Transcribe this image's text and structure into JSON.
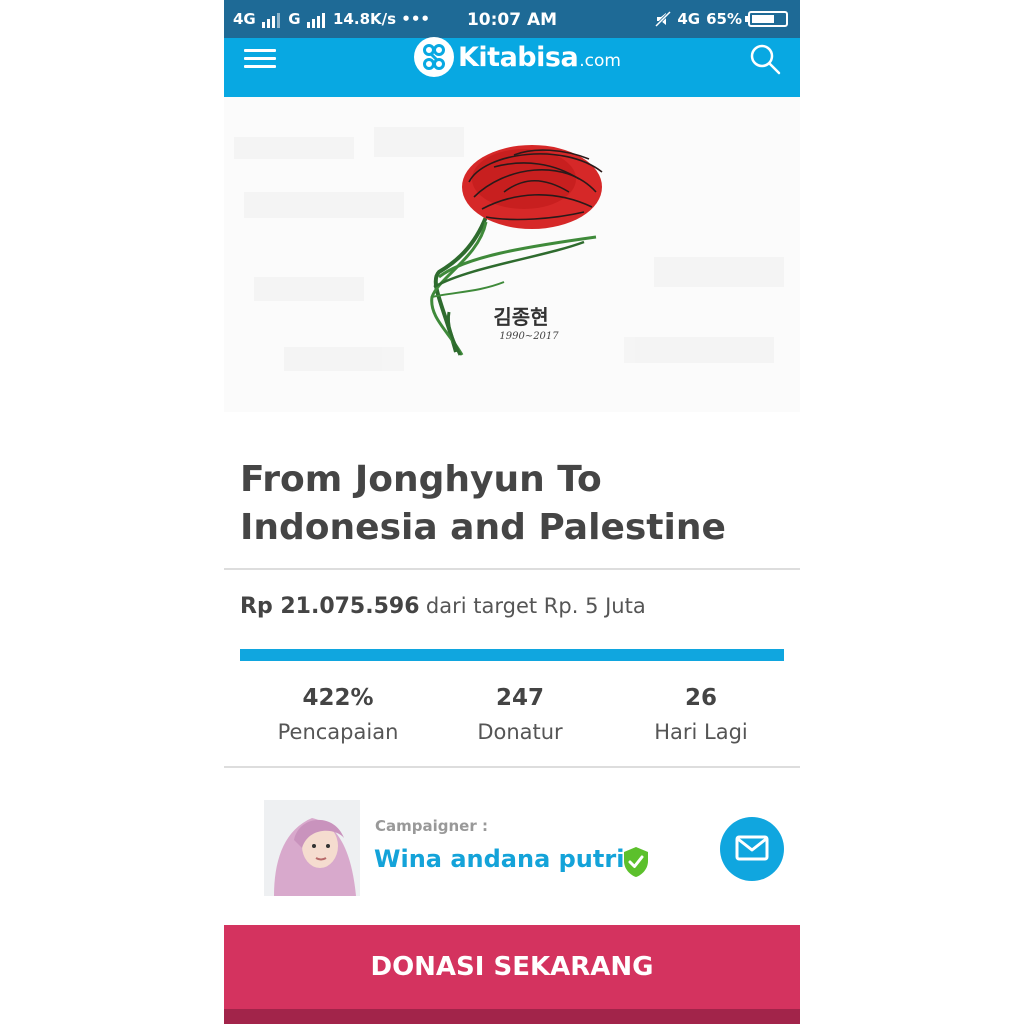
{
  "status_bar": {
    "network": "4G",
    "network2": "G",
    "speed": "14.8K/s •••",
    "time": "10:07 AM",
    "network3": "4G",
    "battery": "65%"
  },
  "header": {
    "logo_text": "Kitabisa",
    "logo_suffix": ".com",
    "menu_icon": "hamburger-menu-icon",
    "search_icon": "search-icon",
    "color": "#08a8e2"
  },
  "campaign_image": {
    "korean_name": "김종현",
    "years": "1990~2017"
  },
  "campaign": {
    "title": "From Jonghyun To Indonesia and Palestine",
    "amount": "Rp 21.075.596",
    "target_text": "dari target Rp. 5 Juta",
    "progress_fraction": 1.0
  },
  "stats": [
    {
      "value": "422%",
      "label": "Pencapaian"
    },
    {
      "value": "247",
      "label": "Donatur"
    },
    {
      "value": "26",
      "label": "Hari Lagi"
    }
  ],
  "campaigner": {
    "caption": "Campaigner :",
    "name": "Wina andana putri",
    "verified_icon": "verified-shield-icon",
    "message_icon": "envelope-icon"
  },
  "donate_button": {
    "label": "DONASI SEKARANG",
    "color": "#d4335f"
  }
}
